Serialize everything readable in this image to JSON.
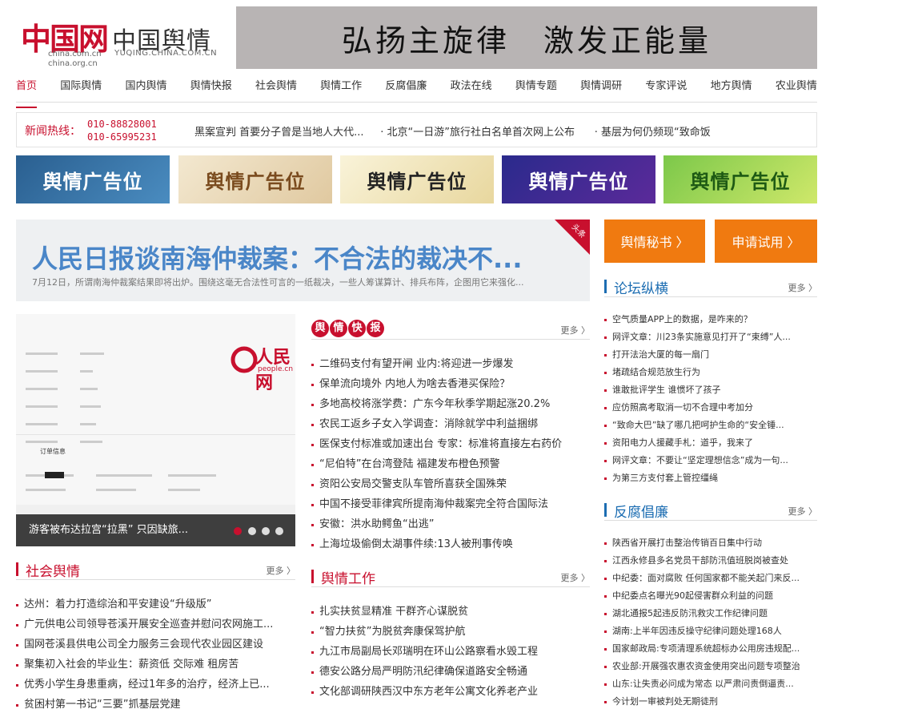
{
  "header": {
    "logo_cn": "中国网",
    "logo_sub1": "china.com.cn",
    "logo_sub2": "china.org.cn",
    "site_title": "中国舆情",
    "site_domain": "YUQING.CHINA.COM.CN",
    "banner_text": "弘扬主旋律　激发正能量"
  },
  "nav": [
    "首页",
    "国际舆情",
    "国内舆情",
    "舆情快报",
    "社会舆情",
    "舆情工作",
    "反腐倡廉",
    "政法在线",
    "舆情专题",
    "舆情调研",
    "专家评说",
    "地方舆情",
    "农业舆情"
  ],
  "hotline": {
    "label": "新闻热线：",
    "num1": "010-88828001",
    "num2": "010-65995231",
    "news": [
      "黑案宣判 首要分子曾是当地人大代...",
      "· 北京“一日游”旅行社白名单首次网上公布",
      "· 基层为何仍频现“致命饭"
    ]
  },
  "ads": [
    "舆情广告位",
    "舆情广告位",
    "舆情广告位",
    "舆情广告位",
    "舆情广告位"
  ],
  "headline": {
    "title": "人民日报谈南海仲裁案：不合法的裁决不...",
    "summary": "7月12日，所谓南海仲裁案结果即将出炉。围绕这毫无合法性可言的一纸裁决，一些人筹谋算计、排兵布阵，企图用它来强化...",
    "corner": "头条"
  },
  "buttons": {
    "secretary": "舆情秘书 〉",
    "trial": "申请试用 〉"
  },
  "photo": {
    "caption": "游客被布达拉宫“拉黑” 只因缺旅...",
    "logo": "人民网",
    "logo_sub": "people.cn",
    "form_title": "订单信息"
  },
  "quick": {
    "badge": [
      "舆",
      "情",
      "快",
      "报"
    ],
    "more": "更多 〉",
    "items": [
      "二维码支付有望开闸 业内:将迎进一步爆发",
      "保单流向境外 内地人为啥去香港买保险？",
      "多地高校将涨学费：广东今年秋季学期起涨20.2%",
      "农民工返乡子女入学调查：消除就学中利益捆绑",
      "医保支付标准或加速出台 专家：标准将直接左右药价",
      "“尼伯特”在台湾登陆 福建发布橙色预警",
      "资阳公安局交警支队车管所喜获全国殊荣",
      "中国不接受菲律宾所提南海仲裁案完全符合国际法",
      "安徽：洪水助鳄鱼“出逃”",
      "上海垃圾偷倒太湖事件续:13人被刑事传唤"
    ]
  },
  "forum": {
    "title": "论坛纵横",
    "more": "更多 〉",
    "items": [
      "空气质量APP上的数据，是咋来的？",
      "网评文章：川23条实施意见打开了“束缚”人...",
      "打开法治大厦的每一扇门",
      "堵疏结合规范放生行为",
      "谁敢批评学生 谁惯坏了孩子",
      "应仿照高考取消一切不合理中考加分",
      "“致命大巴”缺了哪几把呵护生命的“安全锤...",
      "资阳电力人援藏手札：道乎，我来了",
      "网评文章：不要让“坚定理想信念”成为一句...",
      "为第三方支付套上管控缰绳"
    ]
  },
  "anticorruption": {
    "title": "反腐倡廉",
    "more": "更多 〉",
    "items": [
      "陕西省开展打击整治传销百日集中行动",
      "江西永修县多名党员干部防汛值班脱岗被查处",
      "中纪委：面对腐败 任何国家都不能关起门来反...",
      "中纪委点名曝光90起侵害群众利益的问题",
      "湖北通报5起违反防汛救灾工作纪律问题",
      "湖南:上半年因违反操守纪律问题处理168人",
      "国家邮政局:专项清理系统超标办公用房违规配...",
      "农业部:开展强农惠农资金使用突出问题专项整治",
      "山东:让失责必问成为常态 以严肃问责倒逼责...",
      "今计划一审被判处无期徒刑"
    ]
  },
  "social": {
    "title": "社会舆情",
    "more": "更多 〉",
    "items": [
      "达州：着力打造综治和平安建设“升级版”",
      "广元供电公司领导苍溪开展安全巡查并慰问农网施工...",
      "国网苍溪县供电公司全力服务三会现代农业园区建设",
      "聚集初入社会的毕业生：薪资低 交际难 租房苦",
      "优秀小学生身患重病，经过1年多的治疗，经济上已...",
      "贫困村第一书记“三要”抓基层党建"
    ]
  },
  "work": {
    "title": "舆情工作",
    "more": "更多 〉",
    "items": [
      "扎实扶贫显精准 干群齐心谋脱贫",
      "“智力扶贫”为脱贫奔康保驾护航",
      "九江市局副局长邓瑞明在环山公路察看水毁工程",
      "德安公路分局严明防汛纪律确保道路安全畅通",
      "文化部调研陕西汉中东方老年公寓文化养老产业"
    ]
  }
}
